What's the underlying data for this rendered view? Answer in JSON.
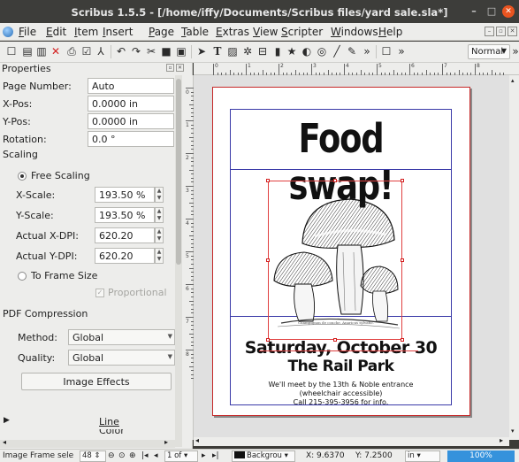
{
  "window": {
    "title": "Scribus 1.5.5 - [/home/iffy/Documents/Scribus files/yard sale.sla*]"
  },
  "menu": {
    "items": [
      "File",
      "Edit",
      "Item",
      "Insert",
      "Page",
      "Table",
      "Extras",
      "View",
      "Scripter",
      "Windows",
      "Help"
    ]
  },
  "toolbar": {
    "overflow_label": "»",
    "mode": "Normal"
  },
  "properties": {
    "title": "Properties",
    "page_number_label": "Page Number:",
    "page_number_value": "Auto",
    "x_pos_label": "X-Pos:",
    "x_pos_value": "0.0000 in",
    "y_pos_label": "Y-Pos:",
    "y_pos_value": "0.0000 in",
    "rotation_label": "Rotation:",
    "rotation_value": "0.0 °",
    "scaling_heading": "Scaling",
    "free_scaling_label": "Free Scaling",
    "x_scale_label": "X-Scale:",
    "x_scale_value": "193.50 %",
    "y_scale_label": "Y-Scale:",
    "y_scale_value": "193.50 %",
    "actual_x_dpi_label": "Actual X-DPI:",
    "actual_x_dpi_value": "620.20",
    "actual_y_dpi_label": "Actual Y-DPI:",
    "actual_y_dpi_value": "620.20",
    "to_frame_size_label": "To Frame Size",
    "proportional_label": "Proportional",
    "pdf_compression_heading": "PDF Compression",
    "method_label": "Method:",
    "method_value": "Global",
    "quality_label": "Quality:",
    "quality_value": "Global",
    "image_effects_label": "Image Effects",
    "line_section_label": "Line",
    "next_section_label": "Color"
  },
  "document": {
    "headline": "Food swap!",
    "image_caption": "Champignon de couche. Anaricus sylvatic.",
    "date_line": "Saturday, October 30",
    "place": "The Rail Park",
    "details_line1": "We'll meet by the 13th & Noble entrance",
    "details_line2": "(wheelchair accessible)",
    "details_line3": "Call 215-395-3956 for info."
  },
  "ruler": {
    "top_ticks": [
      "0",
      "1",
      "2",
      "3",
      "4",
      "5",
      "6",
      "7",
      "8"
    ],
    "left_ticks": [
      "0",
      "1",
      "2",
      "3",
      "4",
      "5",
      "6",
      "7",
      "8"
    ]
  },
  "status": {
    "selection": "Image Frame sele",
    "zoom_step": "48",
    "page_indicator": "1 of",
    "layer": "Backgrou",
    "x_coord": "X: 9.6370",
    "y_coord": "Y: 7.2500",
    "unit": "in",
    "zoom": "100%"
  }
}
